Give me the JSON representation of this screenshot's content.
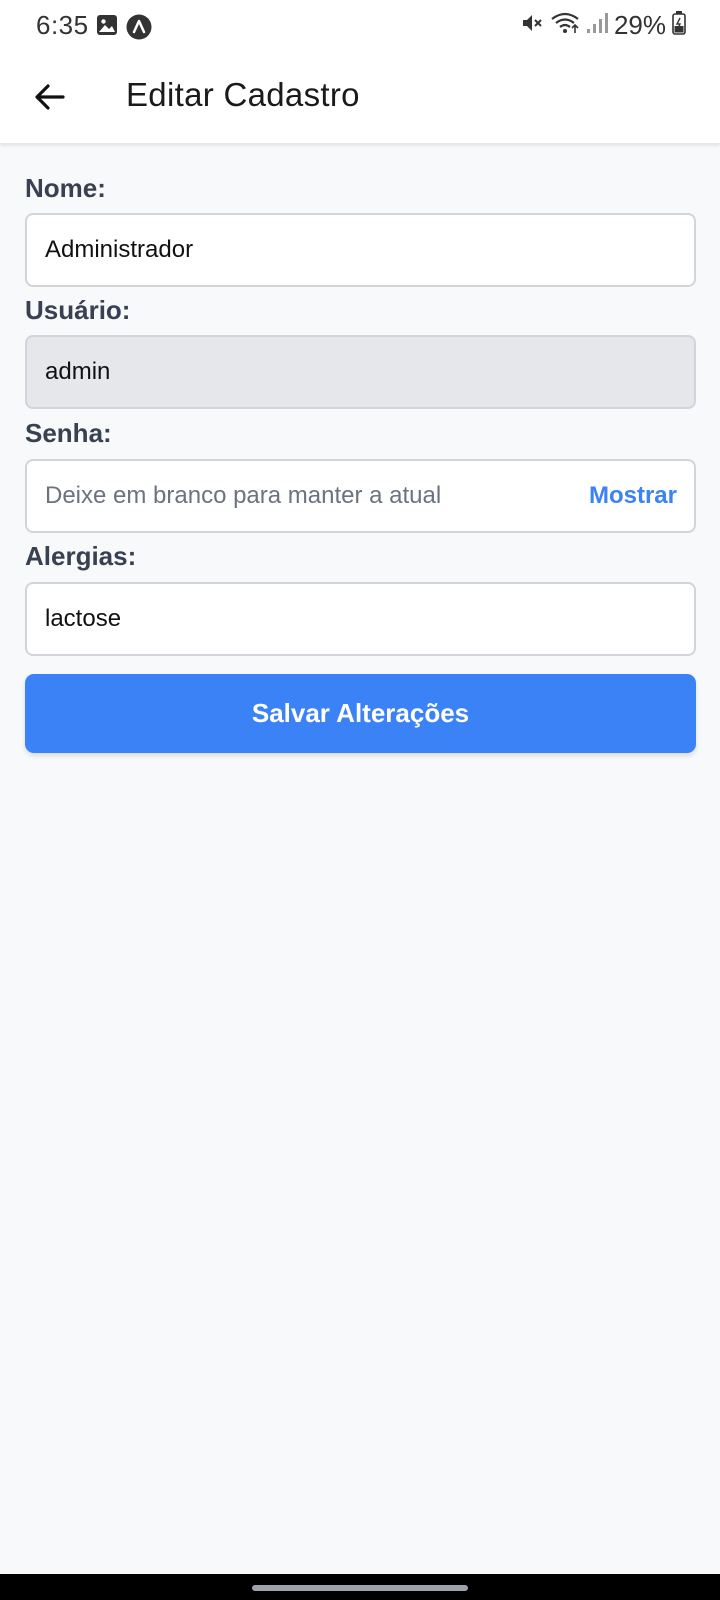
{
  "status_bar": {
    "time": "6:35",
    "battery": "29%",
    "icons": [
      "image-icon",
      "app-notification-icon",
      "mute-icon",
      "wifi-icon",
      "signal-icon",
      "battery-icon"
    ]
  },
  "app_bar": {
    "title": "Editar Cadastro",
    "back_icon": "arrow-left-icon"
  },
  "form": {
    "nome": {
      "label": "Nome:",
      "value": "Administrador"
    },
    "usuario": {
      "label": "Usuário:",
      "value": "admin"
    },
    "senha": {
      "label": "Senha:",
      "placeholder": "Deixe em branco para manter a atual",
      "toggle_label": "Mostrar"
    },
    "alergias": {
      "label": "Alergias:",
      "value": "lactose"
    },
    "save_label": "Salvar Alterações"
  },
  "colors": {
    "accent": "#3b82f6",
    "label": "#374151",
    "background": "#f8f9fb",
    "disabled_input": "#e5e7eb"
  }
}
